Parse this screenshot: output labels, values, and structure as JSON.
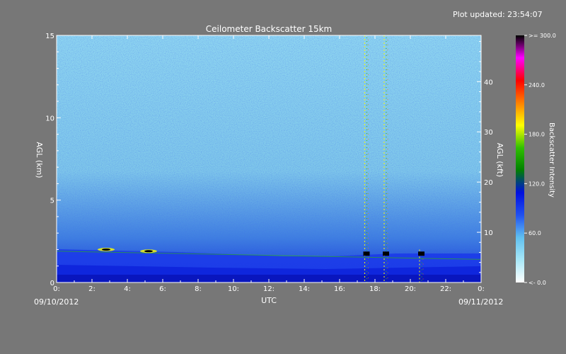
{
  "header": {
    "updated": "Plot updated: 23:54:07"
  },
  "chart_data": {
    "type": "heatmap",
    "title": "Ceilometer Backscatter 15km",
    "xlabel": "UTC",
    "ylabel_left": "AGL (km)",
    "ylabel_right": "AGL (kft)",
    "x_ticks": [
      "0:",
      "2:",
      "4:",
      "6:",
      "8:",
      "10:",
      "12:",
      "14:",
      "16:",
      "18:",
      "20:",
      "22:",
      "0:"
    ],
    "xlim": [
      0,
      24
    ],
    "y_ticks_left": [
      "0",
      "5",
      "10",
      "15"
    ],
    "ylim_left": [
      0,
      15
    ],
    "y_ticks_right": [
      "10",
      "20",
      "30",
      "40"
    ],
    "start_date": "09/10/2012",
    "end_date": "09/11/2012",
    "colorbar": {
      "label": "Backscatter Intensity",
      "range": [
        0,
        300
      ],
      "tick_labels": [
        "<-   0.0",
        "60.0",
        "120.0",
        "180.0",
        "240.0",
        ">= 300.0"
      ],
      "tick_values": [
        0,
        60,
        120,
        180,
        240,
        300
      ],
      "colors": [
        "#ffffff",
        "#a8e8f8",
        "#60c0f0",
        "#2050f0",
        "#0010e0",
        "#008000",
        "#30c000",
        "#ffff00",
        "#ff8000",
        "#ff0000",
        "#ff00ff",
        "#000000"
      ]
    },
    "layers": [
      {
        "feature": "boundary-layer top",
        "x_range": [
          0,
          24
        ],
        "top_km": [
          1.9,
          1.4
        ]
      },
      {
        "feature": "surface layer",
        "x_range": [
          0,
          24
        ],
        "top_km": 0.45
      }
    ],
    "cloud_returns": [
      {
        "x": 17.5,
        "y_km": [
          0,
          15
        ]
      },
      {
        "x": 18.6,
        "y_km": [
          0,
          15
        ]
      },
      {
        "x": 20.6,
        "y_km": [
          0,
          2
        ]
      }
    ],
    "aerosol_patches": [
      {
        "x": 2.8,
        "y_km": 2.0
      },
      {
        "x": 5.2,
        "y_km": 1.9
      }
    ]
  }
}
